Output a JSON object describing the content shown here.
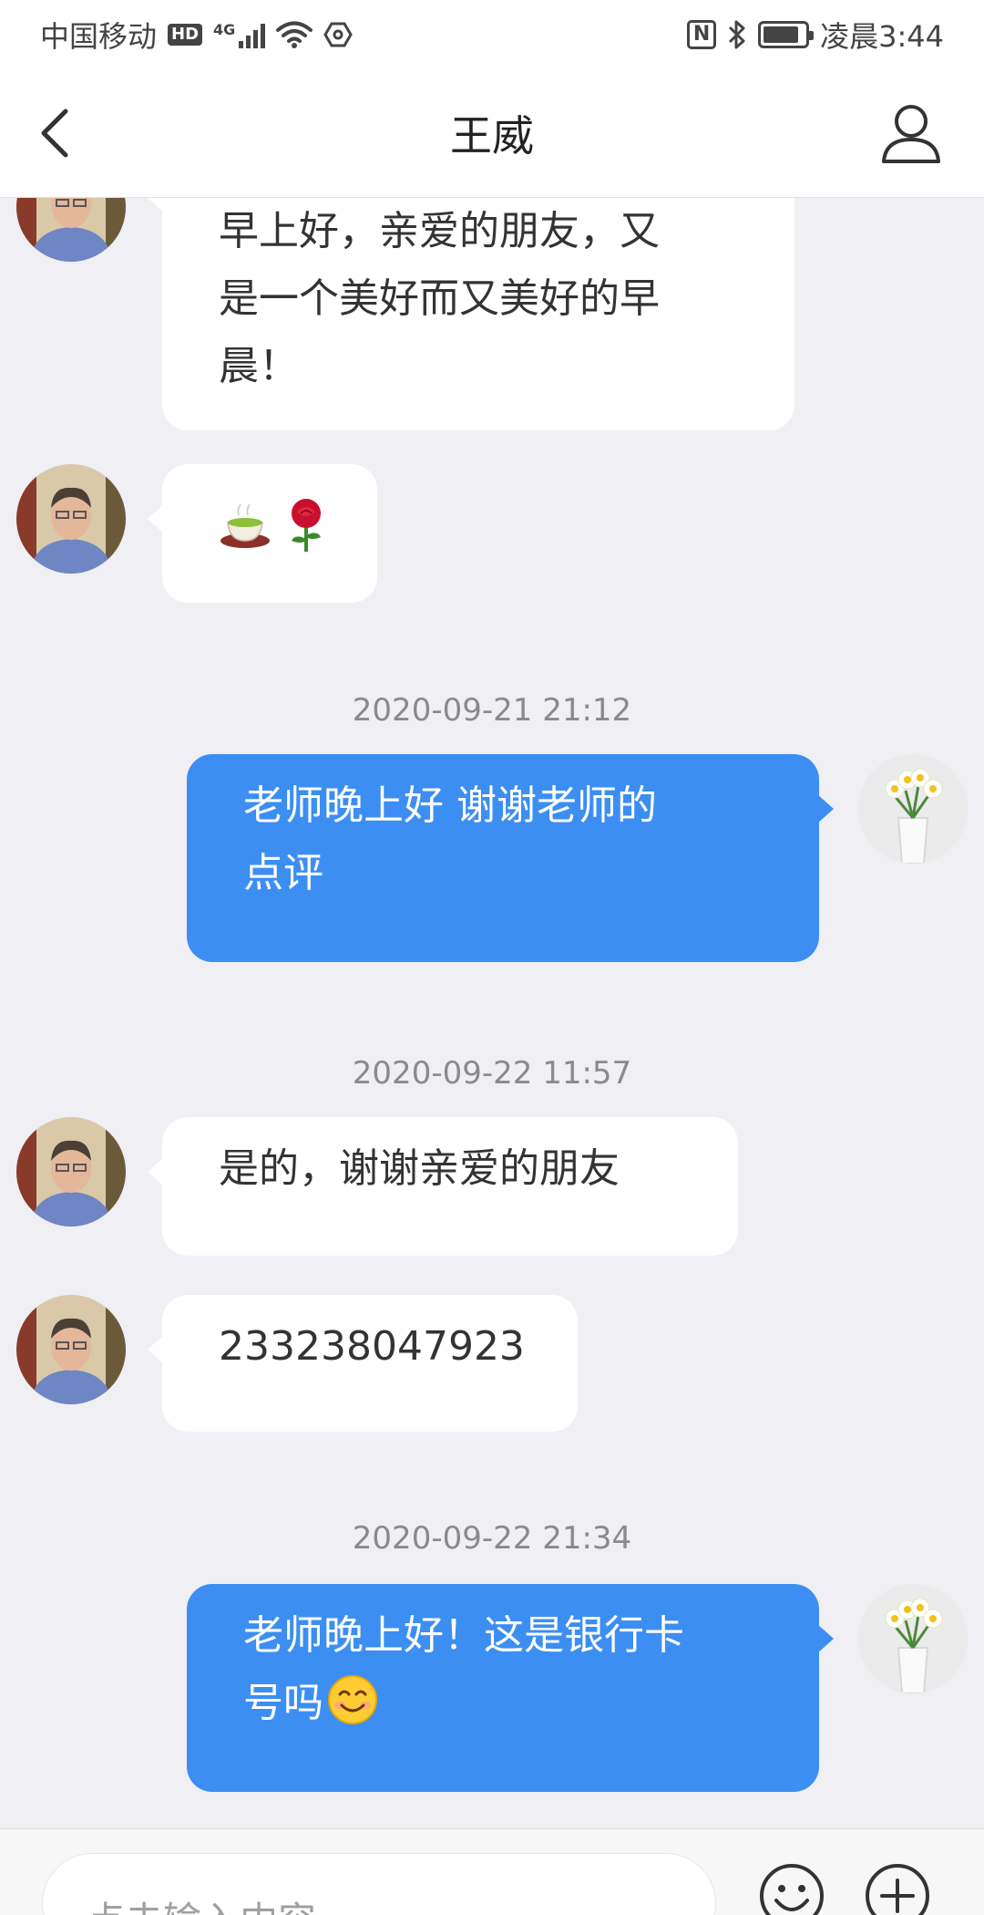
{
  "status_bar": {
    "carrier": "中国移动",
    "hd": "HD",
    "network": "4G",
    "nfc": "N",
    "time": "凌晨3:44",
    "battery_level": 0.85
  },
  "nav": {
    "title": "王威",
    "back_icon": "chevron-left-icon",
    "profile_icon": "person-outline-icon"
  },
  "messages": [
    {
      "side": "in",
      "text": "早上好，亲爱的朋友，又\n是一个美好而又美好的早\n晨！"
    },
    {
      "side": "in",
      "emoji": [
        "tea-cup-icon",
        "rose-icon"
      ]
    },
    {
      "timestamp": "2020-09-21 21:12"
    },
    {
      "side": "out",
      "text": "老师晚上好  谢谢老师的\n点评"
    },
    {
      "timestamp": "2020-09-22 11:57"
    },
    {
      "side": "in",
      "text": "是的，谢谢亲爱的朋友"
    },
    {
      "side": "in",
      "text": "233238047923"
    },
    {
      "timestamp": "2020-09-22 21:34"
    },
    {
      "side": "out",
      "text": "老师晚上好！这是银行卡\n号吗",
      "trailing_emoji": "smiling-face-icon"
    }
  ],
  "input": {
    "placeholder": "点击输入内容",
    "emoji_icon": "smiley-icon",
    "plus_icon": "plus-circle-icon"
  },
  "colors": {
    "outgoing_bubble": "#3c8ef2",
    "incoming_bubble": "#ffffff",
    "background": "#efeff4"
  }
}
